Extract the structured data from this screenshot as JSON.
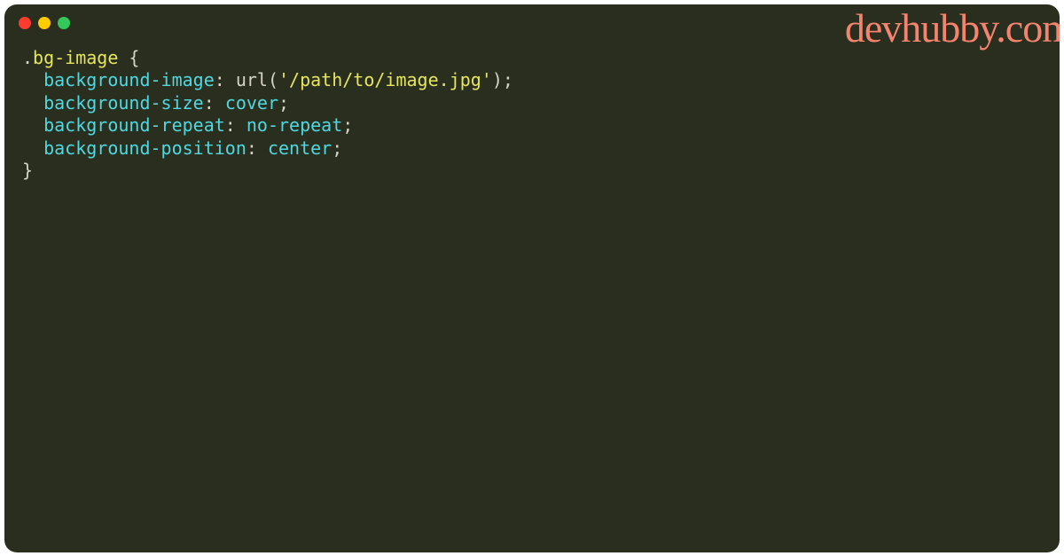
{
  "watermark": "devhubby.com",
  "code": {
    "line1": {
      "dot": ".",
      "selector": "bg-image",
      "space_brace": " {"
    },
    "line2": {
      "indent": "  ",
      "property": "background-image",
      "colon": ": ",
      "func": "url",
      "paren_open": "(",
      "string": "'/path/to/image.jpg'",
      "paren_close": ")",
      "semi": ";"
    },
    "line3": {
      "indent": "  ",
      "property": "background-size",
      "colon": ": ",
      "value": "cover",
      "semi": ";"
    },
    "line4": {
      "indent": "  ",
      "property": "background-repeat",
      "colon": ": ",
      "value": "no-repeat",
      "semi": ";"
    },
    "line5": {
      "indent": "  ",
      "property": "background-position",
      "colon": ": ",
      "value": "center",
      "semi": ";"
    },
    "line6": {
      "brace": "}"
    }
  }
}
